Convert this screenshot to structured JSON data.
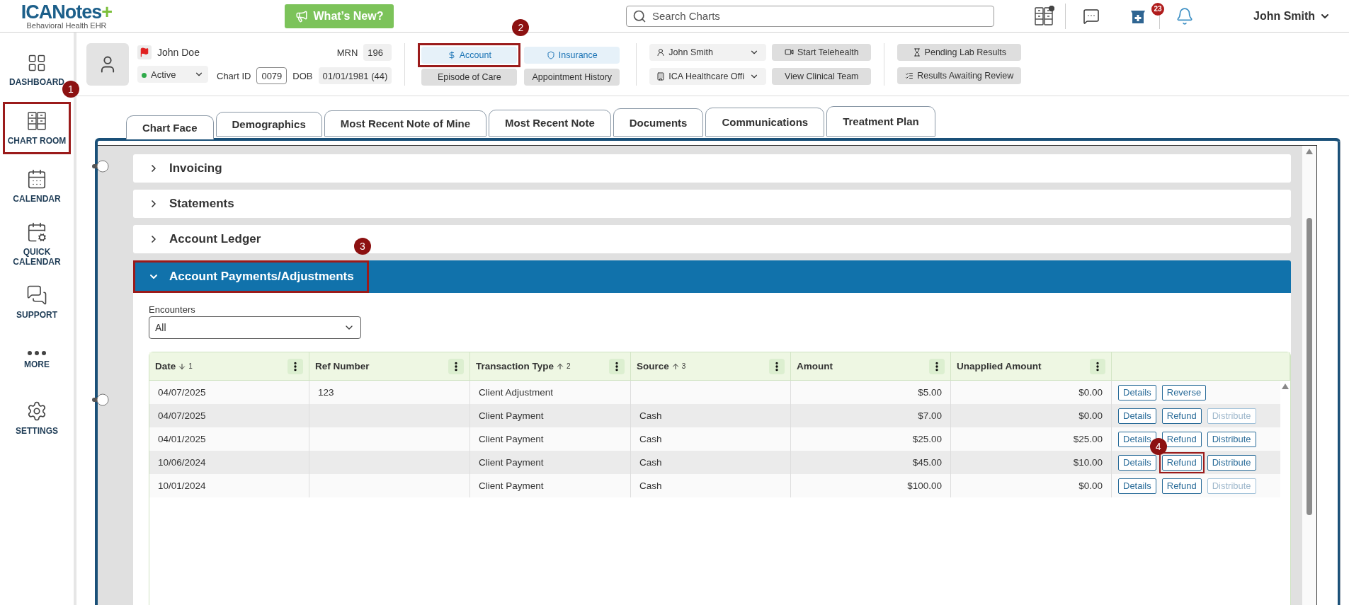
{
  "header": {
    "logo": "ICANotes",
    "logo_plus": "+",
    "logo_subtitle": "Behavioral Health EHR",
    "whats_new": "What’s New?",
    "search": {
      "placeholder": "Search Charts"
    },
    "notification_count": "23",
    "user": "John Smith"
  },
  "sidebar": {
    "items": [
      {
        "label": "DASHBOARD",
        "highlighted": false
      },
      {
        "label": "CHART ROOM",
        "highlighted": true,
        "callout": "1"
      },
      {
        "label": "CALENDAR",
        "highlighted": false
      },
      {
        "label": "QUICK CALENDAR",
        "highlighted": false
      },
      {
        "label": "SUPPORT",
        "highlighted": false
      },
      {
        "label": "MORE",
        "highlighted": false
      },
      {
        "label": "SETTINGS",
        "highlighted": false
      }
    ]
  },
  "patient": {
    "name": "John Doe",
    "status": "Active",
    "chart_id_label": "Chart ID",
    "chart_id": "0079",
    "mrn_label": "MRN",
    "mrn": "196",
    "dob_label": "DOB",
    "dob": "01/01/1981 (44)"
  },
  "account_buttons": [
    {
      "label": "Account",
      "highlighted": true,
      "callout": "2"
    },
    {
      "label": "Insurance",
      "highlighted": false
    }
  ],
  "chart_buttons": [
    "Episode of Care",
    "Appointment History"
  ],
  "provider": "John Smith",
  "location": "ICA Healthcare Offi",
  "action_buttons": [
    "Start Telehealth",
    "View Clinical Team"
  ],
  "lab_buttons": [
    "Pending Lab Results",
    "Results Awaiting Review"
  ],
  "tabs": [
    {
      "label": "Chart Face",
      "selected": true
    },
    {
      "label": "Demographics",
      "selected": false
    },
    {
      "label": "Most Recent Note of Mine",
      "selected": false
    },
    {
      "label": "Most Recent Note",
      "selected": false
    },
    {
      "label": "Documents",
      "selected": false
    },
    {
      "label": "Communications",
      "selected": false
    },
    {
      "label": "Treatment Plan",
      "selected": false
    }
  ],
  "sections": [
    {
      "title": "Invoicing",
      "expanded": false,
      "highlighted": false
    },
    {
      "title": "Statements",
      "expanded": false,
      "highlighted": false
    },
    {
      "title": "Account Ledger",
      "expanded": false,
      "highlighted": false
    },
    {
      "title": "Account Payments/Adjustments",
      "expanded": true,
      "highlighted": true,
      "callout": "3"
    }
  ],
  "encounters": {
    "label": "Encounters",
    "value": "All"
  },
  "table": {
    "columns": [
      {
        "label": "Date",
        "sort_descending": true,
        "sort_order": "1",
        "menu": true
      },
      {
        "label": "Ref Number",
        "menu": true
      },
      {
        "label": "Transaction Type",
        "sort_descending": false,
        "sort_order": "2",
        "menu": true
      },
      {
        "label": "Source",
        "sort_descending": false,
        "sort_order": "3",
        "menu": true
      },
      {
        "label": "Amount",
        "menu": true
      },
      {
        "label": "Unapplied Amount",
        "menu": true
      },
      {
        "menu": false
      }
    ],
    "rows": [
      {
        "date": "04/07/2025",
        "ref": "123",
        "type": "Client Adjustment",
        "source": "",
        "amount": "$5.00",
        "unapplied": "$0.00",
        "actions": [
          {
            "label": "Details",
            "disabled": false,
            "highlighted": false
          },
          {
            "label": "Reverse",
            "disabled": false,
            "highlighted": false
          }
        ]
      },
      {
        "date": "04/07/2025",
        "ref": "",
        "type": "Client Payment",
        "source": "Cash",
        "amount": "$7.00",
        "unapplied": "$0.00",
        "actions": [
          {
            "label": "Details",
            "disabled": false,
            "highlighted": false
          },
          {
            "label": "Refund",
            "disabled": false,
            "highlighted": false
          },
          {
            "label": "Distribute",
            "disabled": true,
            "highlighted": false
          }
        ]
      },
      {
        "date": "04/01/2025",
        "ref": "",
        "type": "Client Payment",
        "source": "Cash",
        "amount": "$25.00",
        "unapplied": "$25.00",
        "actions": [
          {
            "label": "Details",
            "disabled": false,
            "highlighted": false
          },
          {
            "label": "Refund",
            "disabled": false,
            "highlighted": false
          },
          {
            "label": "Distribute",
            "disabled": false,
            "highlighted": false
          }
        ]
      },
      {
        "date": "10/06/2024",
        "ref": "",
        "type": "Client Payment",
        "source": "Cash",
        "amount": "$45.00",
        "unapplied": "$10.00",
        "actions": [
          {
            "label": "Details",
            "disabled": false,
            "highlighted": false
          },
          {
            "label": "Refund",
            "disabled": false,
            "highlighted": true,
            "callout": "4"
          },
          {
            "label": "Distribute",
            "disabled": false,
            "highlighted": false
          }
        ]
      },
      {
        "date": "10/01/2024",
        "ref": "",
        "type": "Client Payment",
        "source": "Cash",
        "amount": "$100.00",
        "unapplied": "$0.00",
        "actions": [
          {
            "label": "Details",
            "disabled": false,
            "highlighted": false
          },
          {
            "label": "Refund",
            "disabled": false,
            "highlighted": false
          },
          {
            "label": "Distribute",
            "disabled": true,
            "highlighted": false
          }
        ]
      }
    ]
  }
}
